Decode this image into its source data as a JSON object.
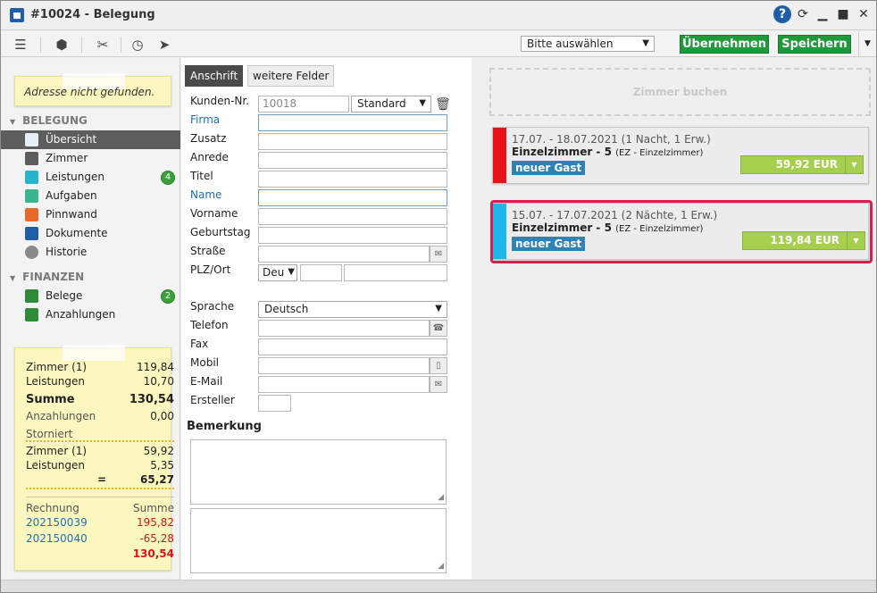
{
  "window": {
    "title": "#10024 - Belegung",
    "help_label": "?"
  },
  "toolbar": {
    "select_value": "Bitte auswählen",
    "apply_label": "Übernehmen",
    "save_label": "Speichern"
  },
  "sidebar": {
    "note": "Adresse nicht gefunden.",
    "sections": {
      "belegung": "BELEGUNG",
      "finanzen": "FINANZEN"
    },
    "items": [
      {
        "label": "Übersicht",
        "icon": "overview-icon",
        "color": "#1e5fa8"
      },
      {
        "label": "Zimmer",
        "icon": "room-icon",
        "color": "#5d5d5d"
      },
      {
        "label": "Leistungen",
        "icon": "services-icon",
        "color": "#27b6c9",
        "badge": "4"
      },
      {
        "label": "Aufgaben",
        "icon": "tasks-icon",
        "color": "#3ab58f"
      },
      {
        "label": "Pinnwand",
        "icon": "pinboard-icon",
        "color": "#e8682a"
      },
      {
        "label": "Dokumente",
        "icon": "documents-icon",
        "color": "#1e5fa8"
      },
      {
        "label": "Historie",
        "icon": "history-icon",
        "color": "#8a8a8a"
      }
    ],
    "finance_items": [
      {
        "label": "Belege",
        "icon": "receipts-icon",
        "color": "#2f8a3a",
        "badge": "2"
      },
      {
        "label": "Anzahlungen",
        "icon": "deposits-icon",
        "color": "#2f8a3a"
      }
    ]
  },
  "summary": {
    "zimmer_label": "Zimmer (1)",
    "zimmer_value": "119,84",
    "leistungen_label": "Leistungen",
    "leistungen_value": "10,70",
    "summe_label": "Summe",
    "summe_value": "130,54",
    "anzahlungen_label": "Anzahlungen",
    "anzahlungen_value": "0,00",
    "storniert_label": "Storniert",
    "st_zimmer_label": "Zimmer (1)",
    "st_zimmer_value": "59,92",
    "st_leistungen_label": "Leistungen",
    "st_leistungen_value": "5,35",
    "st_eq": "=",
    "st_total": "65,27",
    "rechnung_label": "Rechnung",
    "rsumme_label": "Summe",
    "invoices": [
      {
        "number": "202150039",
        "amount": "195,82"
      },
      {
        "number": "202150040",
        "amount": "-65,28"
      }
    ],
    "invoice_total": "130,54"
  },
  "form": {
    "tabs": [
      "Anschrift",
      "weitere Felder"
    ],
    "labels": {
      "kunden_nr": "Kunden-Nr.",
      "firma": "Firma",
      "zusatz": "Zusatz",
      "anrede": "Anrede",
      "titel": "Titel",
      "name": "Name",
      "vorname": "Vorname",
      "geburtstag": "Geburtstag",
      "strasse": "Straße",
      "plz_ort": "PLZ/Ort",
      "sprache": "Sprache",
      "telefon": "Telefon",
      "fax": "Fax",
      "mobil": "Mobil",
      "email": "E-Mail",
      "ersteller": "Ersteller"
    },
    "kunden_nr_value": "10018",
    "standard_value": "Standard",
    "country_value": "Deu",
    "sprache_value": "Deutsch",
    "bemerkung": "Bemerkung"
  },
  "bookings": {
    "book_room_label": "Zimmer buchen",
    "cards": [
      {
        "dates": "17.07. - 18.07.2021 (1 Nacht, 1 Erw.)",
        "room": "Einzelzimmer - 5",
        "room_type": "(EZ - Einzelzimmer)",
        "guest": "neuer Gast",
        "price": "59,92 EUR",
        "stripe_color": "#e8121b"
      },
      {
        "dates": "15.07. - 17.07.2021 (2 Nächte, 1 Erw.)",
        "room": "Einzelzimmer - 5",
        "room_type": "(EZ - Einzelzimmer)",
        "guest": "neuer Gast",
        "price": "119,84 EUR",
        "stripe_color": "#1fb6ea"
      }
    ]
  }
}
